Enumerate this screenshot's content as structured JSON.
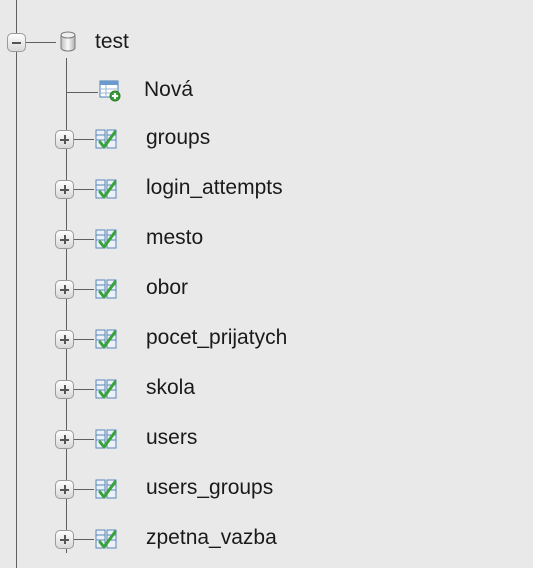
{
  "tree": {
    "database": {
      "name": "test",
      "icon": "database-icon"
    },
    "new_item": {
      "label": "Nová",
      "icon": "new-table-icon"
    },
    "tables": [
      {
        "name": "groups",
        "icon": "table-icon"
      },
      {
        "name": "login_attempts",
        "icon": "table-icon"
      },
      {
        "name": "mesto",
        "icon": "table-icon"
      },
      {
        "name": "obor",
        "icon": "table-icon"
      },
      {
        "name": "pocet_prijatych",
        "icon": "table-icon"
      },
      {
        "name": "skola",
        "icon": "table-icon"
      },
      {
        "name": "users",
        "icon": "table-icon"
      },
      {
        "name": "users_groups",
        "icon": "table-icon"
      },
      {
        "name": "zpetna_vazba",
        "icon": "table-icon"
      }
    ]
  }
}
